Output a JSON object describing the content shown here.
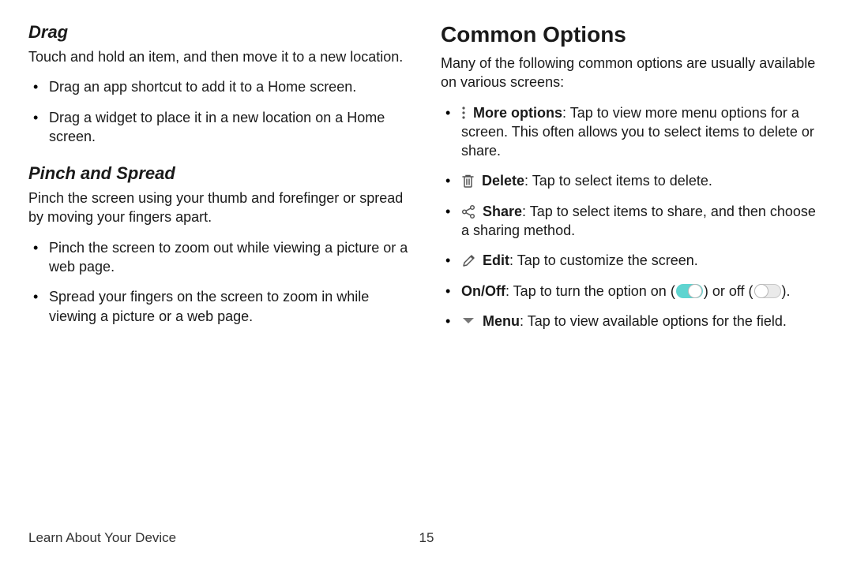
{
  "left": {
    "drag": {
      "heading": "Drag",
      "intro": "Touch and hold an item, and then move it to a new location.",
      "items": [
        "Drag an app shortcut to add it to a Home screen.",
        "Drag a widget to place it in a new location on a Home screen."
      ]
    },
    "pinch": {
      "heading": "Pinch and Spread",
      "intro": "Pinch the screen using your thumb and forefinger or spread by moving your fingers apart.",
      "items": [
        "Pinch the screen to zoom out while viewing a picture or a web page.",
        "Spread your fingers on the screen to zoom in while viewing a picture or a web page."
      ]
    }
  },
  "right": {
    "heading": "Common Options",
    "intro": "Many of the following common options are usually available on various screens:",
    "options": {
      "more": {
        "term": "More options",
        "text": ": Tap to view more menu options for a screen. This often allows you to select items to delete or share."
      },
      "delete": {
        "term": "Delete",
        "text": ": Tap to select items to delete."
      },
      "share": {
        "term": "Share",
        "text": ": Tap to select items to share, and then choose a sharing method."
      },
      "edit": {
        "term": "Edit",
        "text": ": Tap to customize the screen."
      },
      "onoff": {
        "term": "On/Off",
        "pre": ": Tap to turn the option on (",
        "mid": ") or off (",
        "post": ")."
      },
      "menu": {
        "term": "Menu",
        "text": ": Tap to view available options for the field."
      }
    }
  },
  "footer": {
    "label": "Learn About Your Device",
    "page": "15"
  }
}
